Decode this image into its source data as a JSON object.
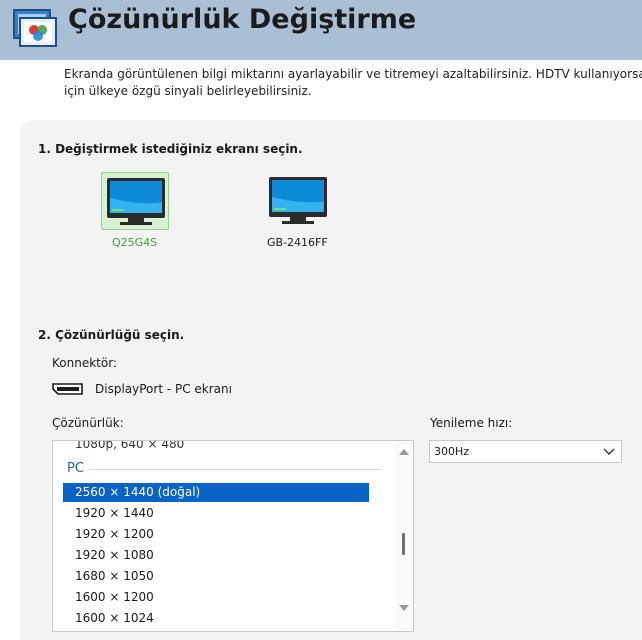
{
  "header": {
    "title": "Çözünürlük Değiştirme",
    "icon": "display-settings-icon"
  },
  "description": {
    "line1": "Ekranda görüntülenen bilgi miktarını ayarlayabilir ve titremeyi azaltabilirsiniz. HDTV kullanıyorsanız",
    "line2": "için ülkeye özgü sinyali belirleyebilirsiniz."
  },
  "step1": {
    "title": "1. Değiştirmek istediğiniz ekranı seçin.",
    "displays": [
      {
        "label": "Q25G4S",
        "selected": true,
        "icon": "monitor-icon"
      },
      {
        "label": "GB-2416FF",
        "selected": false,
        "icon": "monitor-icon"
      }
    ]
  },
  "step2": {
    "title": "2. Çözünürlüğü seçin.",
    "connector_label": "Konnektör:",
    "connector_value": "DisplayPort - PC ekranı",
    "connector_icon": "displayport-icon",
    "resolution_label": "Çözünürlük:",
    "refresh_label": "Yenileme hızı:",
    "refresh_value": "300Hz",
    "resolution_list": {
      "partial_top_item": "1080p, 640 × 480",
      "group": "PC",
      "items": [
        "2560 × 1440 (doğal)",
        "1920 × 1440",
        "1920 × 1200",
        "1920 × 1080",
        "1680 × 1050",
        "1600 × 1200",
        "1600 × 1024"
      ],
      "selected_index": 0
    }
  },
  "colors": {
    "header_bg": "#a9bfd4",
    "selected_bg": "#0a63c7",
    "selected_display_text": "#3aa531",
    "group_text": "#2a5fa8"
  }
}
